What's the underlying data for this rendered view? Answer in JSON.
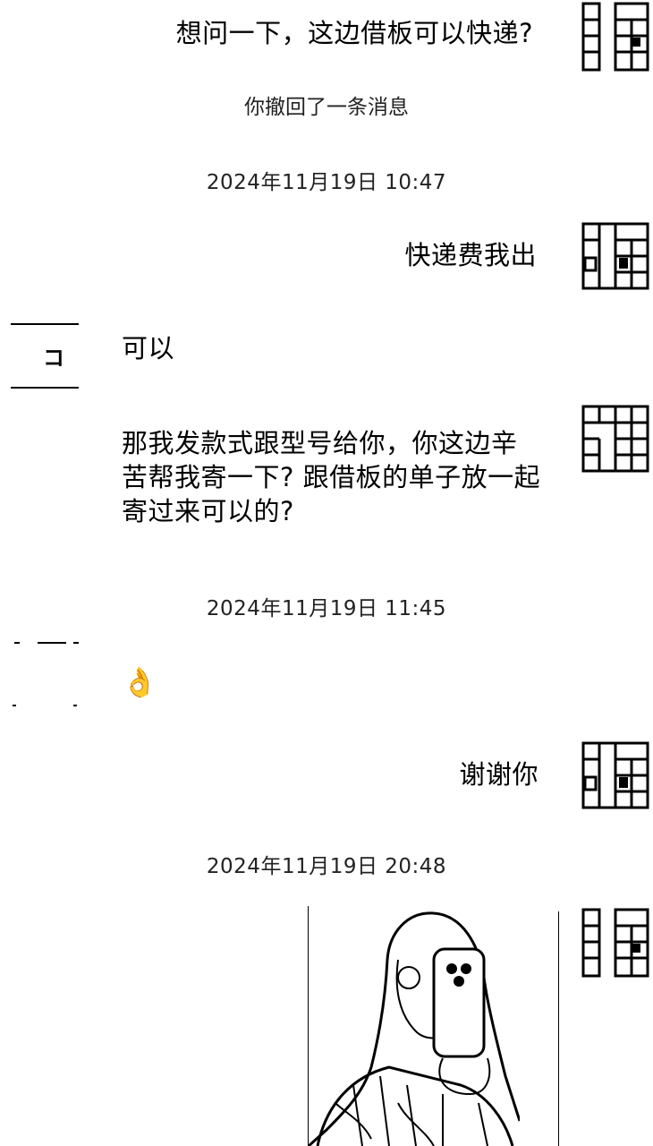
{
  "messages": {
    "m1": "想问一下，这边借板可以快递?",
    "m2": "快递费我出",
    "m3": "可以",
    "m4": "那我发款式跟型号给你，你这边辛苦帮我寄一下? 跟借板的单子放一起寄过来可以的?",
    "m5_emoji": "👌",
    "m6": "谢谢你"
  },
  "system": {
    "recall": "你撤回了一条消息",
    "ts1": "2024年11月19日 10:47",
    "ts2": "2024年11月19日 11:45",
    "ts3": "2024年11月19日 20:48"
  },
  "left_avatar": {
    "glyph": "コ"
  },
  "icons": {
    "self_avatar": "self-avatar-icon",
    "contact_avatar": "contact-avatar-icon",
    "ok_hand": "ok-hand-icon"
  },
  "colors": {
    "text": "#000000",
    "system_text": "#222222",
    "background": "#ffffff"
  }
}
